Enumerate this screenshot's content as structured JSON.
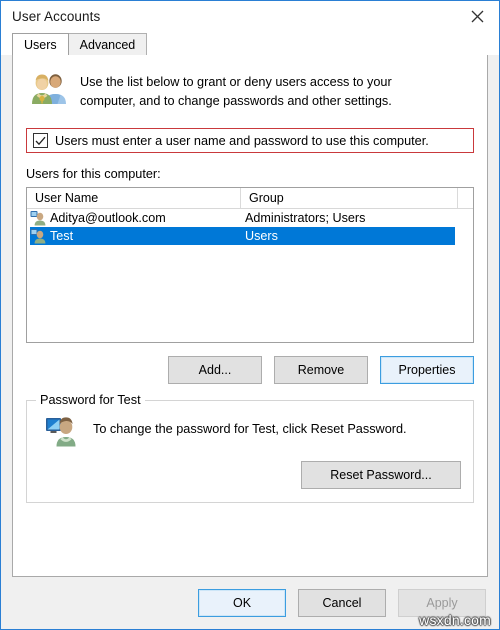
{
  "window": {
    "title": "User Accounts",
    "close_icon": "close-icon",
    "accent_border": "#2a7fd4"
  },
  "tabs": [
    {
      "label": "Users",
      "active": true
    },
    {
      "label": "Advanced",
      "active": false
    }
  ],
  "intro": {
    "icon": "two-users-icon",
    "text": "Use the list below to grant or deny users access to your computer, and to change passwords and other settings."
  },
  "annotation": {
    "border_color": "#c9393c",
    "checkbox_checked": true,
    "label": "Users must enter a user name and password to use this computer."
  },
  "list": {
    "label": "Users for this computer:",
    "columns": [
      "User Name",
      "Group",
      ""
    ],
    "rows": [
      {
        "user_name": "Aditya@outlook.com",
        "group": "Administrators; Users",
        "selected": false,
        "icon": "user-icon"
      },
      {
        "user_name": "Test",
        "group": "Users",
        "selected": true,
        "icon": "user-icon"
      }
    ],
    "selection_color": "#0078d7"
  },
  "actions": {
    "add": "Add...",
    "remove": "Remove",
    "properties": "Properties"
  },
  "password_group": {
    "title": "Password for Test",
    "icon": "user-screen-icon",
    "text": "To change the password for Test, click Reset Password.",
    "reset_button": "Reset Password..."
  },
  "footer": {
    "ok": "OK",
    "cancel": "Cancel",
    "apply": "Apply",
    "apply_disabled": true
  },
  "watermark": "wsxdn.com"
}
